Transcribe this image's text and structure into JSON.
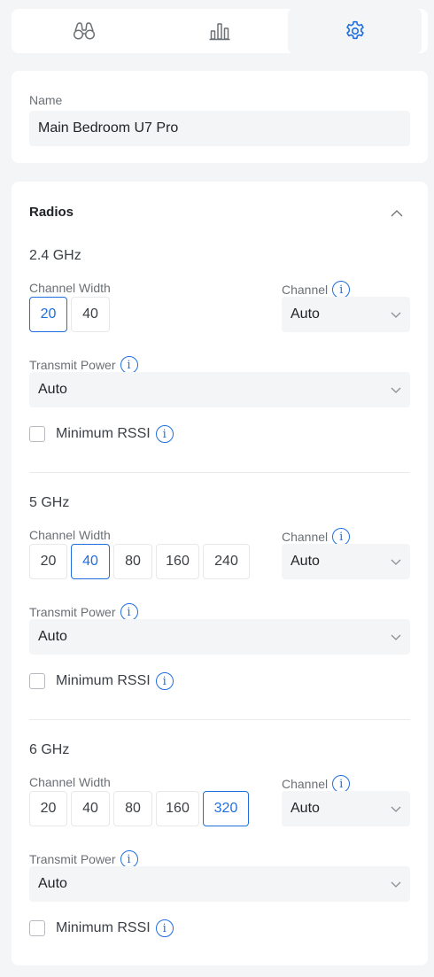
{
  "tabs": [
    {
      "icon": "binoculars-icon",
      "active": false
    },
    {
      "icon": "bar-chart-icon",
      "active": false
    },
    {
      "icon": "gear-icon",
      "active": true
    }
  ],
  "name_section": {
    "label": "Name",
    "value": "Main Bedroom U7 Pro"
  },
  "radios": {
    "title": "Radios",
    "bands": [
      {
        "title": "2.4 GHz",
        "channel_width_label": "Channel Width",
        "channel_widths": [
          "20",
          "40"
        ],
        "selected_width": "20",
        "channel_label": "Channel",
        "channel_value": "Auto",
        "transmit_power_label": "Transmit Power",
        "transmit_power_value": "Auto",
        "min_rssi_label": "Minimum RSSI",
        "min_rssi_checked": false
      },
      {
        "title": "5 GHz",
        "channel_width_label": "Channel Width",
        "channel_widths": [
          "20",
          "40",
          "80",
          "160",
          "240"
        ],
        "selected_width": "40",
        "channel_label": "Channel",
        "channel_value": "Auto",
        "transmit_power_label": "Transmit Power",
        "transmit_power_value": "Auto",
        "min_rssi_label": "Minimum RSSI",
        "min_rssi_checked": false
      },
      {
        "title": "6 GHz",
        "channel_width_label": "Channel Width",
        "channel_widths": [
          "20",
          "40",
          "80",
          "160",
          "320"
        ],
        "selected_width": "320",
        "channel_label": "Channel",
        "channel_value": "Auto",
        "transmit_power_label": "Transmit Power",
        "transmit_power_value": "Auto",
        "min_rssi_label": "Minimum RSSI",
        "min_rssi_checked": false
      }
    ]
  },
  "colors": {
    "accent": "#1f6fdf",
    "icon": "#6b7075",
    "panel_bg": "#f4f5f6",
    "card_bg": "#ffffff"
  }
}
